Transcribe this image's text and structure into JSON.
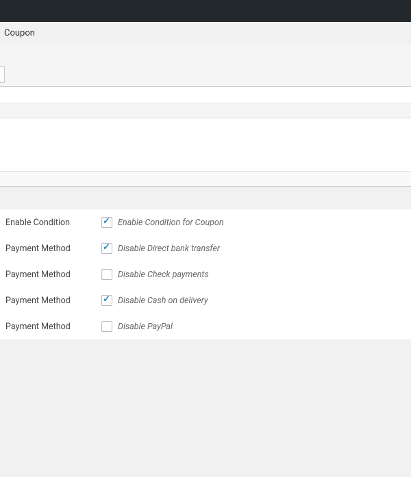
{
  "header": {
    "title": "Coupon"
  },
  "settings": {
    "rows": [
      {
        "label": "Enable Condition",
        "checkbox_label": "Enable Condition for Coupon",
        "checked": true
      },
      {
        "label": "Payment Method",
        "checkbox_label": "Disable Direct bank transfer",
        "checked": true
      },
      {
        "label": "Payment Method",
        "checkbox_label": "Disable Check payments",
        "checked": false
      },
      {
        "label": "Payment Method",
        "checkbox_label": "Disable Cash on delivery",
        "checked": true
      },
      {
        "label": "Payment Method",
        "checkbox_label": "Disable PayPal",
        "checked": false
      }
    ]
  }
}
